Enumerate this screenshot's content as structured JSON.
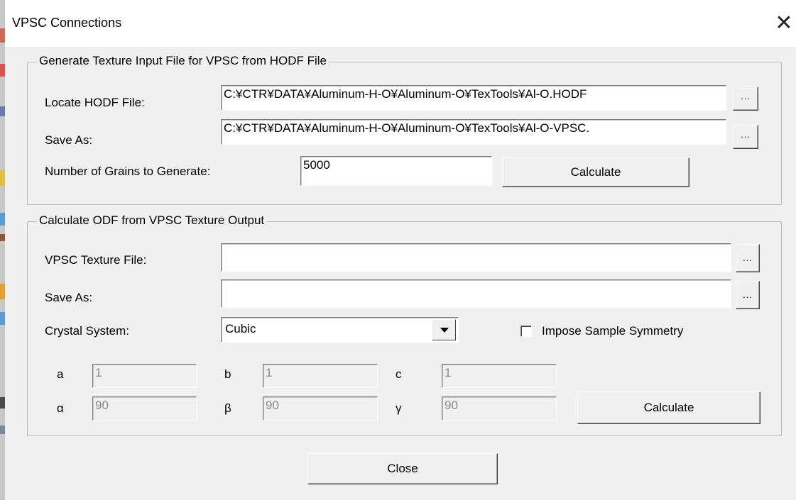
{
  "window": {
    "title": "VPSC Connections",
    "close_glyph": "✕"
  },
  "generate_group": {
    "legend": "Generate Texture Input File for VPSC from HODF File",
    "hodf_label": "Locate HODF File:",
    "hodf_value": "C:¥CTR¥DATA¥Aluminum-H-O¥Aluminum-O¥TexTools¥Al-O.HODF",
    "save_label": "Save As:",
    "save_value": "C:¥CTR¥DATA¥Aluminum-H-O¥Aluminum-O¥TexTools¥Al-O-VPSC.",
    "grains_label": "Number of Grains to Generate:",
    "grains_value": "5000",
    "calculate_label": "Calculate",
    "browse_label": "..."
  },
  "odf_group": {
    "legend": "Calculate ODF from VPSC Texture Output",
    "texture_label": "VPSC Texture File:",
    "texture_value": "",
    "save_label": "Save As:",
    "save_value": "",
    "crystal_label": "Crystal System:",
    "crystal_value": "Cubic",
    "impose_label": "Impose Sample Symmetry",
    "impose_checked": false,
    "browse_label": "...",
    "params": {
      "a_label": "a",
      "a_value": "1",
      "b_label": "b",
      "b_value": "1",
      "c_label": "c",
      "c_value": "1",
      "alpha_label": "α",
      "alpha_value": "90",
      "beta_label": "β",
      "beta_value": "90",
      "gamma_label": "γ",
      "gamma_value": "90"
    },
    "calculate_label": "Calculate"
  },
  "close_button_label": "Close"
}
